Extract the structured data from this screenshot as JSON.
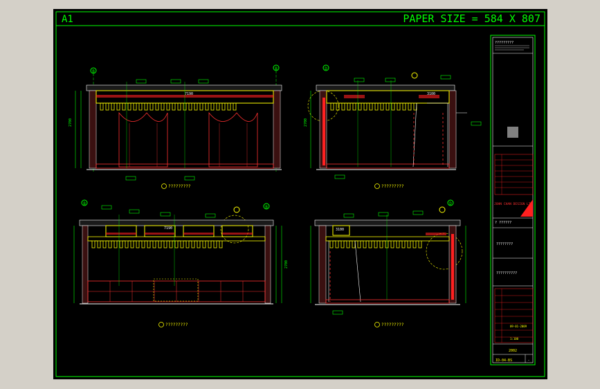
{
  "sheet": {
    "size_label": "A1",
    "paper_size": "PAPER SIZE = 584 X 807"
  },
  "elevations": {
    "top_left": {
      "grid_a": "B",
      "grid_b": "B",
      "dim": "7190",
      "title": "?????????"
    },
    "top_right": {
      "grid_a": "D",
      "grid_b": "B",
      "dim": "3100",
      "title": "?????????"
    },
    "bottom_left": {
      "grid_a": "B",
      "grid_b": "B",
      "dim": "7190",
      "title": "?????????"
    },
    "bottom_right": {
      "grid_a": "D",
      "grid_b": "B",
      "dim": "3100",
      "title": "?????????"
    }
  },
  "title_block": {
    "header": "?????????",
    "company": "JOHN CHAN DESIGN LTD",
    "project": "????????",
    "drawing_title": "??????????",
    "drawing_no": "ID-04-BS",
    "date": "09-01-2009",
    "scale": "1:100",
    "sheet_no": "2002",
    "revision": "-"
  },
  "colors": {
    "frame": "#00ff00",
    "line": "#ffff00",
    "accent": "#ff2020",
    "background": "#000000"
  }
}
